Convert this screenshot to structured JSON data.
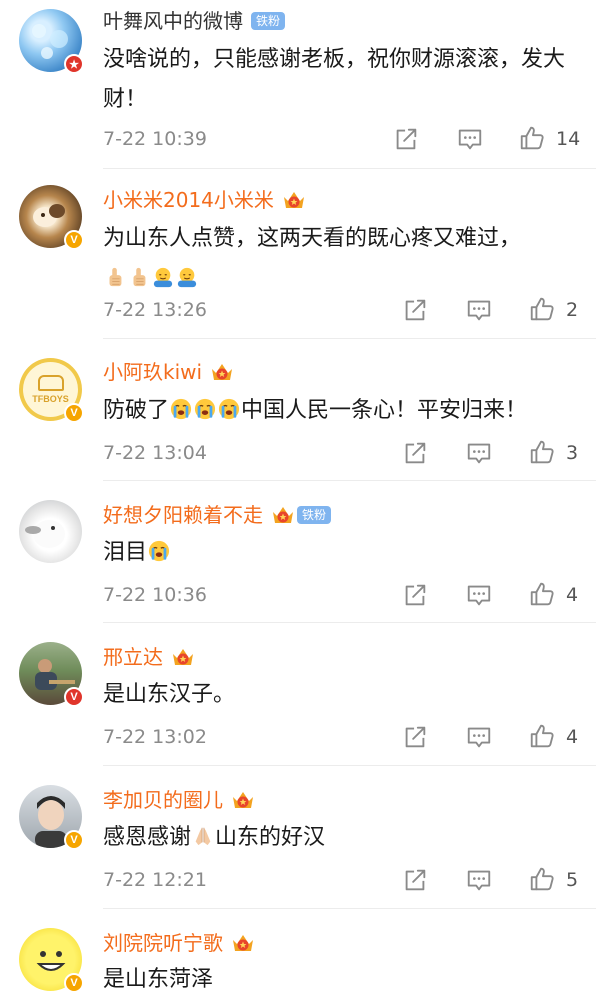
{
  "colors": {
    "name_orange": "#f36c1c",
    "name_gray": "#333333",
    "fan_badge_blue": "#7fb4ef",
    "verified_gold": "#f6a500",
    "verified_red": "#e0352b",
    "meta_gray": "#8a8a8a"
  },
  "icons": {
    "share": "share-icon",
    "comment": "comment-icon",
    "like": "thumbs-up-icon",
    "crown": "member-crown-icon",
    "verified": "verified-v-icon"
  },
  "comments": [
    {
      "username": "叶舞风中的微博",
      "fan_badge": "铁粉",
      "text": "没啥说的，只能感谢老板，祝你财源滚滚，发大财！",
      "time": "7-22 10:39",
      "likes": "14"
    },
    {
      "username": "小米米2014小米米",
      "crown_level": "5",
      "text": "为山东人点赞，这两天看的既心疼又难过，",
      "time": "7-22 13:26",
      "likes": "2"
    },
    {
      "username": "小阿玖kiwi",
      "crown_level": "5",
      "avatar_label": "TFBOYS",
      "text_before": "防破了",
      "text_after": "中国人民一条心！平安归来！",
      "time": "7-22 13:04",
      "likes": "3"
    },
    {
      "username": "好想夕阳赖着不走",
      "crown_level": "6",
      "fan_badge": "铁粉",
      "text": "泪目",
      "time": "7-22 10:36",
      "likes": "4"
    },
    {
      "username": "邢立达",
      "crown_level": "7",
      "text": "是山东汉子。",
      "time": "7-22 13:02",
      "likes": "4"
    },
    {
      "username": "李加贝的圈儿",
      "crown_level": "6",
      "text_before": "感恩感谢",
      "text_after": "山东的好汉",
      "time": "7-22 12:21",
      "likes": "5"
    },
    {
      "username": "刘院院听宁歌",
      "crown_level": "6",
      "text": "是山东菏泽"
    }
  ]
}
